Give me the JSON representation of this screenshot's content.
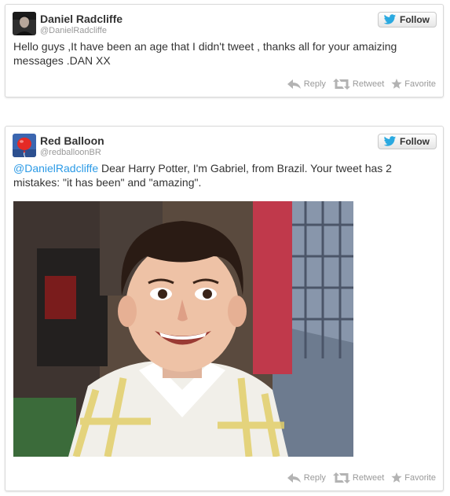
{
  "tweets": [
    {
      "name": "Daniel Radcliffe",
      "handle": "@DanielRadcliffe",
      "avatar_icon": "user-avatar-dark",
      "follow_label": "Follow",
      "text": "Hello guys ,It have been an age that I didn't tweet , thanks all for your amaizing messages .DAN XX",
      "actions": {
        "reply": "Reply",
        "retweet": "Retweet",
        "favorite": "Favorite"
      }
    },
    {
      "name": "Red Balloon",
      "handle": "@redballoonBR",
      "avatar_icon": "red-balloon-logo",
      "follow_label": "Follow",
      "mention": "@DanielRadcliffe",
      "text": " Dear Harry Potter, I'm Gabriel, from Brazil. Your tweet has 2 mistakes: \"it has been\" and \"amazing\".",
      "photo_icon": "photo-smiling-boy",
      "actions": {
        "reply": "Reply",
        "retweet": "Retweet",
        "favorite": "Favorite"
      }
    }
  ],
  "colors": {
    "link": "#2b9ae6",
    "twitter_blue": "#2aa9e0",
    "muted": "#999999",
    "text": "#333333"
  }
}
